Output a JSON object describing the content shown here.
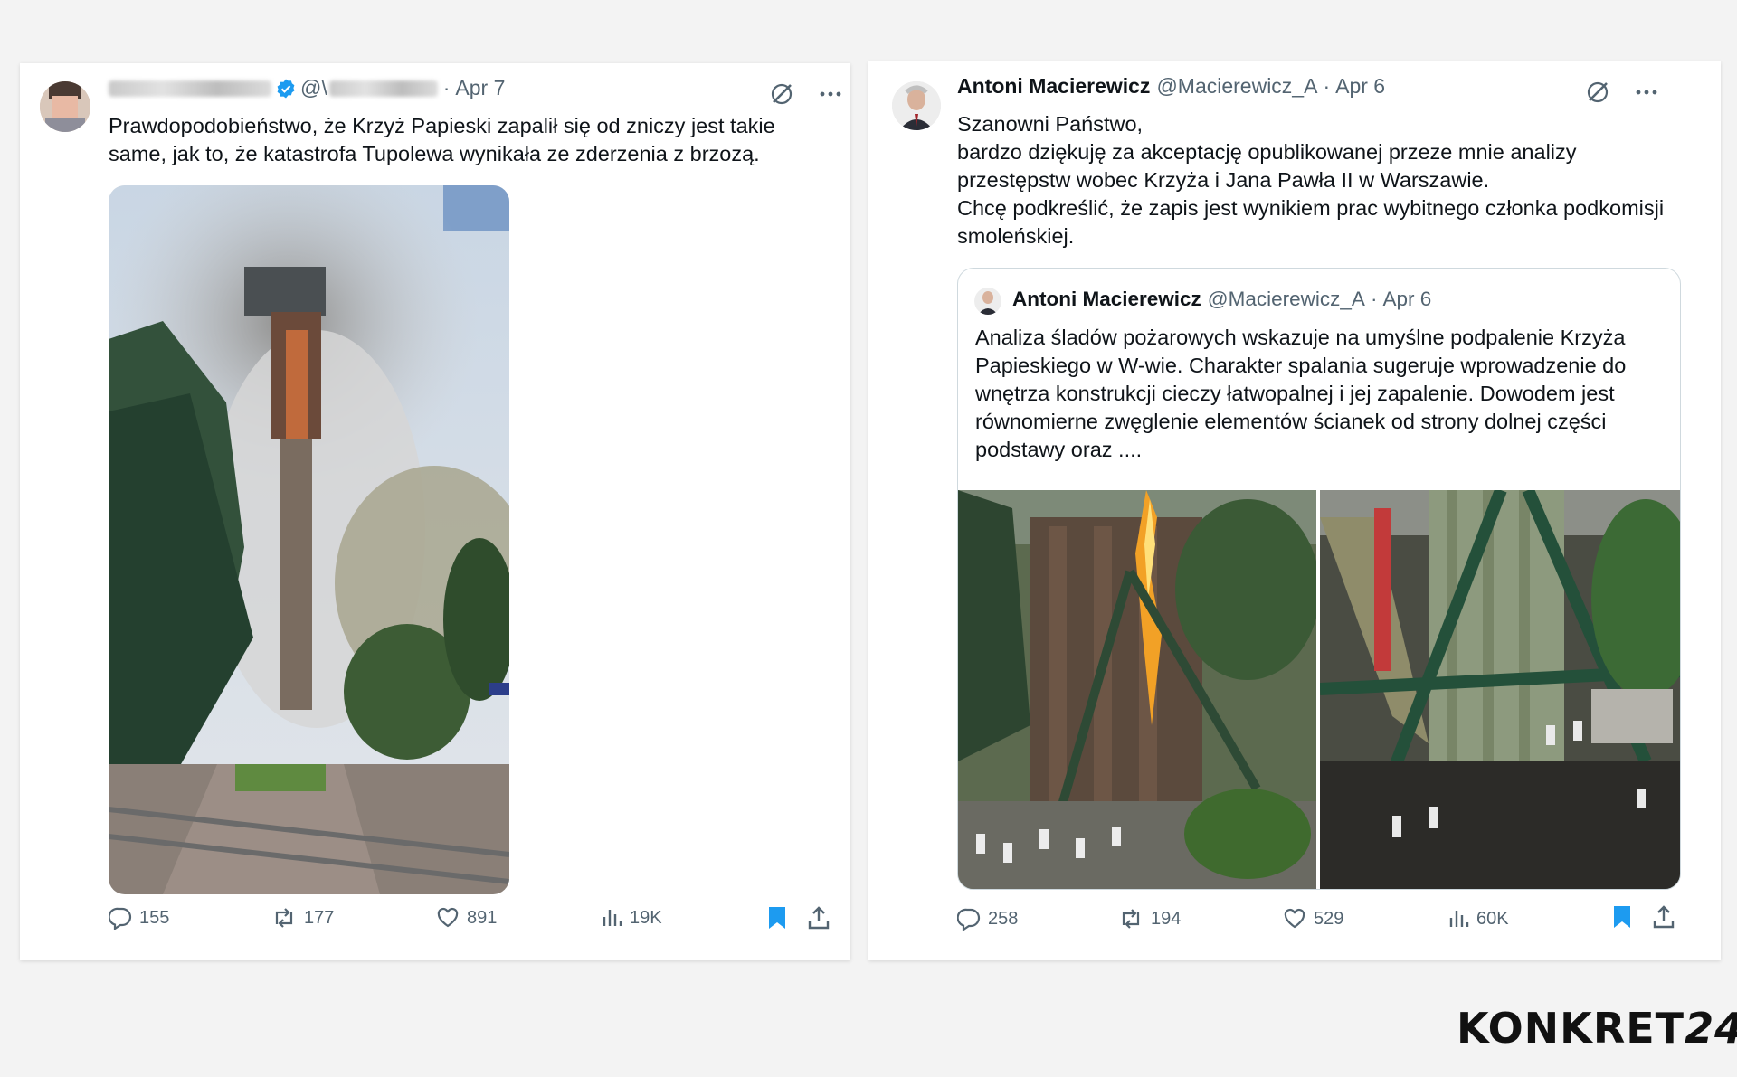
{
  "left_tweet": {
    "handle_prefix": "@\\",
    "separator": "·",
    "date": "Apr 7",
    "text": "Prawdopodobieństwo, że Krzyż Papieski zapalił się od zniczy jest takie\nsame, jak to, że katastrofa Tupolewa wynikała ze zderzenia z brzozą.",
    "actions": {
      "replies": "155",
      "reposts": "177",
      "likes": "891",
      "views": "19K"
    }
  },
  "right_tweet": {
    "name": "Antoni Macierewicz",
    "handle": "@Macierewicz_A",
    "separator": "·",
    "date": "Apr 6",
    "text": "Szanowni Państwo,\nbardzo dziękuję za akceptację opublikowanej przeze mnie analizy\nprzestępstw wobec Krzyża i Jana Pawła II w Warszawie.\nChcę podkreślić, że zapis jest wynikiem prac wybitnego członka podkomisji\nsmoleńskiej.",
    "quote": {
      "name": "Antoni Macierewicz",
      "handle": "@Macierewicz_A",
      "separator": "·",
      "date": "Apr 6",
      "text": "Analiza śladów pożarowych wskazuje na umyślne podpalenie Krzyża\nPapieskiego w W-wie. Charakter spalania sugeruje wprowadzenie do\nwnętrza konstrukcji cieczy łatwopalnej i jej zapalenie. Dowodem jest\nrównomierne zwęglenie elementów ścianek od strony dolnej części\npodstawy oraz ...."
    },
    "actions": {
      "replies": "258",
      "reposts": "194",
      "likes": "529",
      "views": "60K"
    }
  },
  "branding": {
    "logo_text": "KONKRET",
    "logo_number": "24"
  },
  "colors": {
    "accent": "#1d9bf0",
    "muted": "#536471",
    "text": "#0f1419"
  },
  "icons": [
    "verified-badge-icon",
    "grok-icon",
    "more-icon",
    "reply-icon",
    "repost-icon",
    "like-icon",
    "views-icon",
    "bookmark-icon",
    "share-icon"
  ]
}
